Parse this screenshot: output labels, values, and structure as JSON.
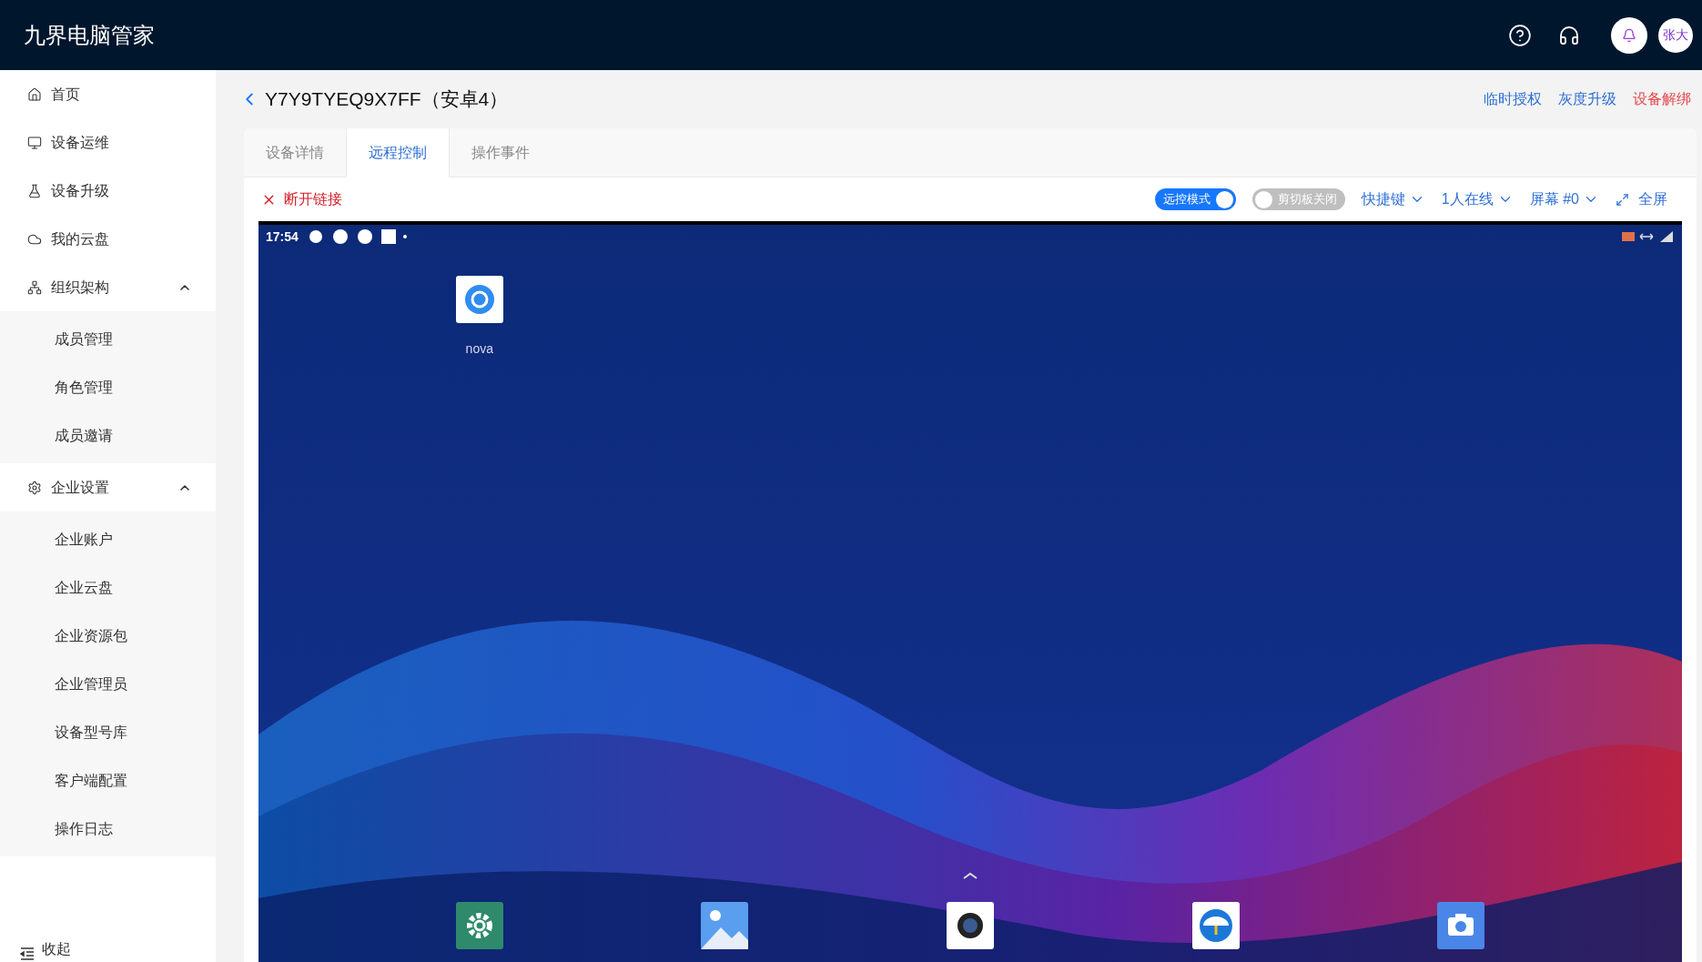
{
  "app_title": "九界电脑管家",
  "header": {
    "avatar": "张大"
  },
  "sidebar": {
    "items": [
      {
        "label": "首页",
        "kind": "link"
      },
      {
        "label": "设备运维",
        "kind": "link"
      },
      {
        "label": "设备升级",
        "kind": "link"
      },
      {
        "label": "我的云盘",
        "kind": "link"
      },
      {
        "label": "组织架构",
        "kind": "group",
        "expanded": true,
        "children": [
          {
            "label": "成员管理"
          },
          {
            "label": "角色管理"
          },
          {
            "label": "成员邀请"
          }
        ]
      },
      {
        "label": "企业设置",
        "kind": "group",
        "expanded": true,
        "children": [
          {
            "label": "企业账户"
          },
          {
            "label": "企业云盘"
          },
          {
            "label": "企业资源包"
          },
          {
            "label": "企业管理员"
          },
          {
            "label": "设备型号库"
          },
          {
            "label": "客户端配置"
          },
          {
            "label": "操作日志"
          }
        ]
      }
    ],
    "collapse": "收起"
  },
  "page": {
    "title": "Y7Y9TYEQ9X7FF（安卓4）",
    "actions": [
      {
        "label": "临时授权",
        "kind": "normal"
      },
      {
        "label": "灰度升级",
        "kind": "normal"
      },
      {
        "label": "设备解绑",
        "kind": "danger"
      }
    ]
  },
  "tabs": [
    {
      "label": "设备详情",
      "selected": false
    },
    {
      "label": "远程控制",
      "selected": true
    },
    {
      "label": "操作事件",
      "selected": false
    }
  ],
  "toolbar": {
    "disconnect": "断开链接",
    "toggles": [
      {
        "label": "远控模式",
        "on": true
      },
      {
        "label": "剪切板关闭",
        "on": false
      }
    ],
    "dropdowns": [
      "快捷键",
      "1人在线",
      "屏幕 #0"
    ],
    "fullscreen": "全屏"
  },
  "remote_screen": {
    "time": "17:54",
    "apps": [
      {
        "label": "nova"
      }
    ]
  }
}
